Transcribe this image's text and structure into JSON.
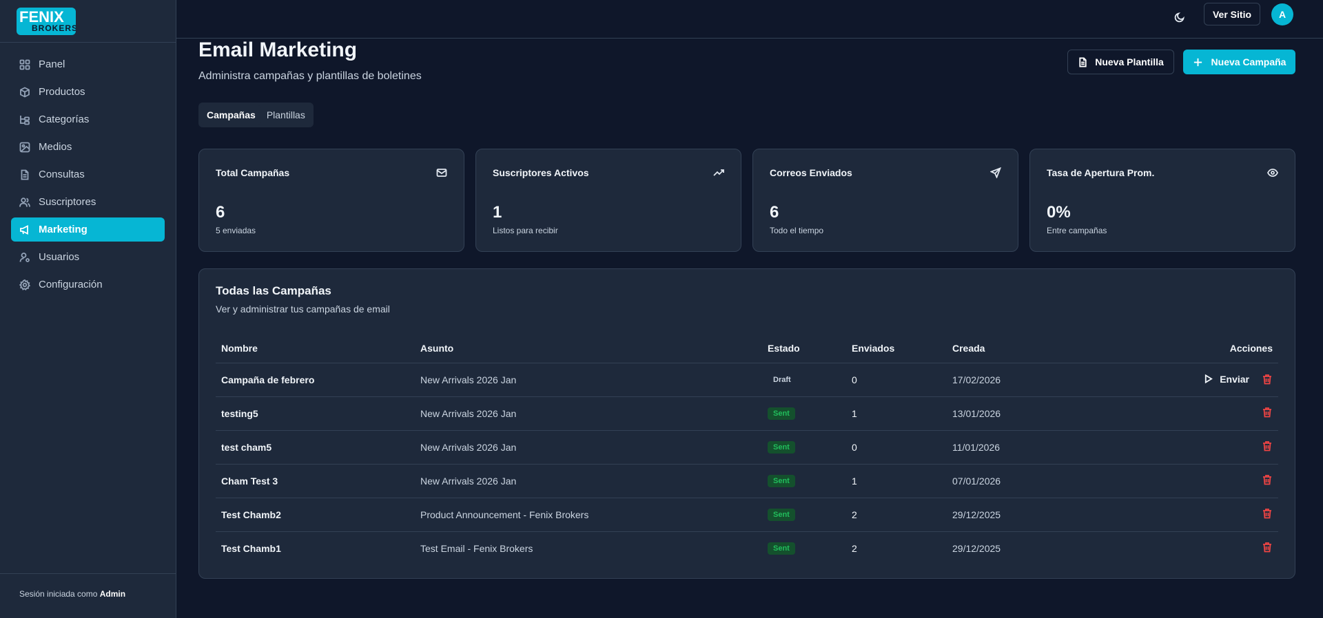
{
  "brand": {
    "logo_line1": "FENIX",
    "logo_line2": "BROKERS",
    "accent": "#06b6d4"
  },
  "sidebar": {
    "items": [
      {
        "label": "Panel",
        "icon": "grid-icon"
      },
      {
        "label": "Productos",
        "icon": "box-icon"
      },
      {
        "label": "Categorías",
        "icon": "folder-tree-icon"
      },
      {
        "label": "Medios",
        "icon": "image-icon"
      },
      {
        "label": "Consultas",
        "icon": "file-text-icon"
      },
      {
        "label": "Suscriptores",
        "icon": "users-icon"
      },
      {
        "label": "Marketing",
        "icon": "megaphone-icon",
        "active": true
      },
      {
        "label": "Usuarios",
        "icon": "user-cog-icon"
      },
      {
        "label": "Configuración",
        "icon": "gear-icon"
      }
    ],
    "footer_prefix": "Sesión iniciada como",
    "footer_user": "Admin"
  },
  "topbar": {
    "site_button": "Ver Sitio",
    "avatar_initial": "A",
    "theme_icon": "moon-icon"
  },
  "header": {
    "title": "Email Marketing",
    "subtitle": "Administra campañas y plantillas de boletines",
    "new_template": "Nueva Plantilla",
    "new_campaign": "Nueva Campaña"
  },
  "tabs": [
    "Campañas",
    "Plantillas"
  ],
  "stats": [
    {
      "title": "Total Campañas",
      "value": "6",
      "desc": "5 enviadas",
      "icon": "mail-icon"
    },
    {
      "title": "Suscriptores Activos",
      "value": "1",
      "desc": "Listos para recibir",
      "icon": "trending-up-icon"
    },
    {
      "title": "Correos Enviados",
      "value": "6",
      "desc": "Todo el tiempo",
      "icon": "send-icon"
    },
    {
      "title": "Tasa de Apertura Prom.",
      "value": "0%",
      "desc": "Entre campañas",
      "icon": "eye-icon"
    }
  ],
  "campaigns": {
    "title": "Todas las Campañas",
    "subtitle": "Ver y administrar tus campañas de email",
    "columns": [
      "Nombre",
      "Asunto",
      "Estado",
      "Enviados",
      "Creada",
      "Acciones"
    ],
    "send_label": "Enviar",
    "rows": [
      {
        "name": "Campaña de febrero",
        "subject": "New Arrivals 2026 Jan",
        "status": "Draft",
        "sent": "0",
        "created": "17/02/2026"
      },
      {
        "name": "testing5",
        "subject": "New Arrivals 2026 Jan",
        "status": "Sent",
        "sent": "1",
        "created": "13/01/2026"
      },
      {
        "name": "test cham5",
        "subject": "New Arrivals 2026 Jan",
        "status": "Sent",
        "sent": "0",
        "created": "11/01/2026"
      },
      {
        "name": "Cham Test 3",
        "subject": "New Arrivals 2026 Jan",
        "status": "Sent",
        "sent": "1",
        "created": "07/01/2026"
      },
      {
        "name": "Test Chamb2",
        "subject": "Product Announcement - Fenix Brokers",
        "status": "Sent",
        "sent": "2",
        "created": "29/12/2025"
      },
      {
        "name": "Test Chamb1",
        "subject": "Test Email - Fenix Brokers",
        "status": "Sent",
        "sent": "2",
        "created": "29/12/2025"
      }
    ]
  }
}
